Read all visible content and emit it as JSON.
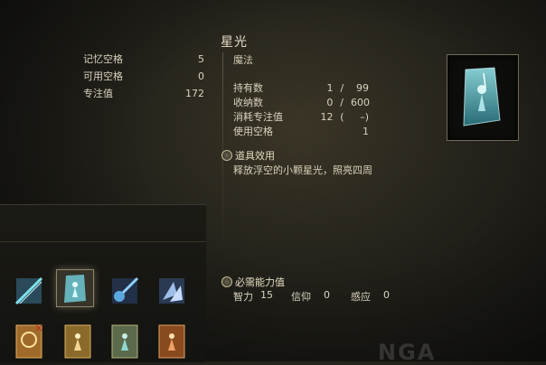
{
  "stats": [
    {
      "label": "记忆空格",
      "value": "5"
    },
    {
      "label": "可用空格",
      "value": "0"
    },
    {
      "label": "专注值",
      "value": "172"
    }
  ],
  "item": {
    "title": "星光",
    "type": "魔法",
    "props": [
      {
        "label": "持有数",
        "v1": "1",
        "sep": "/",
        "v2": "99"
      },
      {
        "label": "收纳数",
        "v1": "0",
        "sep": "/",
        "v2": "600"
      },
      {
        "label": "消耗专注值",
        "v1": "12",
        "sep": "(",
        "v2": "–)"
      },
      {
        "label": "使用空格",
        "v1": "",
        "sep": "",
        "v2": "1"
      }
    ],
    "effect_heading": "道具效用",
    "effect_text": "释放浮空的小颗星光，照亮四周",
    "requirements_heading": "必需能力值",
    "requirements": [
      {
        "label": "智力",
        "value": "15"
      },
      {
        "label": "信仰",
        "value": "0"
      },
      {
        "label": "感应",
        "value": "0"
      }
    ]
  },
  "watermark": "NGA",
  "colors": {
    "accent_cyan": "#7fe3ee",
    "text": "#d9d3bf",
    "divider": "#5d5747"
  },
  "slots": [
    {
      "icon": "blue-spear-spell-icon"
    },
    {
      "icon": "glintstone-figure-spell-icon",
      "selected": true
    },
    {
      "icon": "blue-comet-spell-icon"
    },
    {
      "icon": "crystal-shards-spell-icon"
    },
    {
      "icon": "golden-incantation-icon"
    },
    {
      "icon": "golden-figure-incantation-icon"
    },
    {
      "icon": "teal-figure-incantation-icon"
    },
    {
      "icon": "flame-figure-incantation-icon"
    }
  ]
}
